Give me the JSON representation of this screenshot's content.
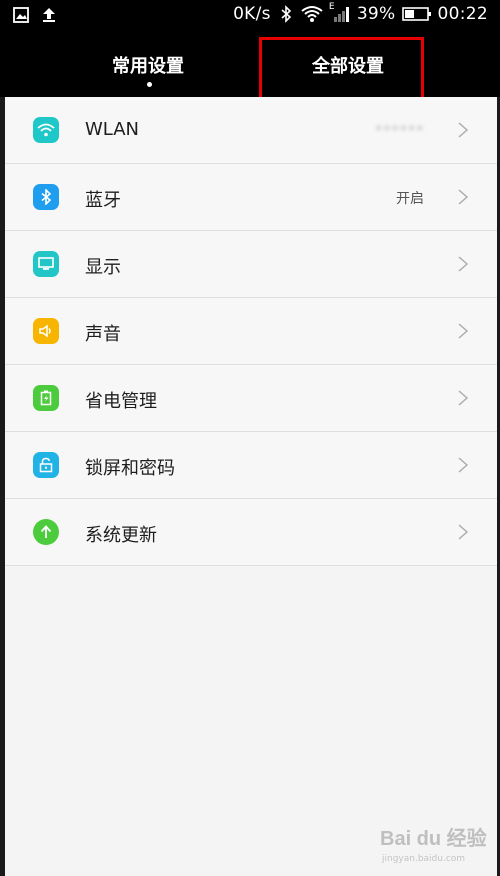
{
  "status_bar": {
    "speed": "0K/s",
    "network": "E",
    "battery": "39%",
    "time": "00:22"
  },
  "tabs": [
    {
      "label": "常用设置",
      "active": true
    },
    {
      "label": "全部设置",
      "active": false
    }
  ],
  "settings": [
    {
      "label": "WLAN",
      "value": "••••••",
      "icon": "wifi-icon",
      "color": "#1fc8c8"
    },
    {
      "label": "蓝牙",
      "value": "开启",
      "icon": "bluetooth-icon",
      "color": "#1f9ef0"
    },
    {
      "label": "显示",
      "value": "",
      "icon": "display-icon",
      "color": "#22c6c6"
    },
    {
      "label": "声音",
      "value": "",
      "icon": "sound-icon",
      "color": "#f7b500"
    },
    {
      "label": "省电管理",
      "value": "",
      "icon": "battery-icon",
      "color": "#4ccc3c"
    },
    {
      "label": "锁屏和密码",
      "value": "",
      "icon": "lock-icon",
      "color": "#22b3e6"
    },
    {
      "label": "系统更新",
      "value": "",
      "icon": "update-icon",
      "color": "#4ccc3c"
    }
  ],
  "watermark": {
    "logo": "Bai du 经验",
    "site": "jingyan.baidu.com"
  },
  "colors": {
    "highlight": "#e60000",
    "header_bg": "#000000",
    "list_bg": "#f7f7f7"
  }
}
